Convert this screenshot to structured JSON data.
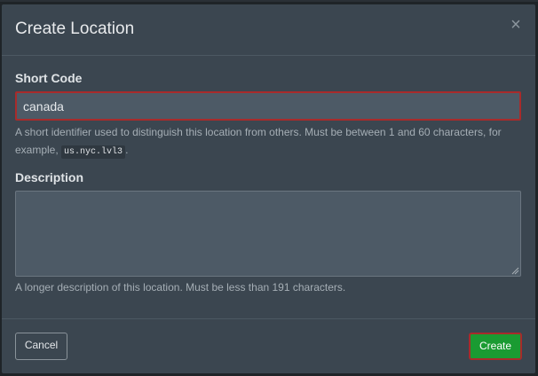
{
  "modal": {
    "title": "Create Location",
    "close_glyph": "×"
  },
  "short_code": {
    "label": "Short Code",
    "value": "canada",
    "help_text": "A short identifier used to distinguish this location from others. Must be between 1 and 60 characters, for example,",
    "help_example": "us.nyc.lvl3",
    "help_suffix": "."
  },
  "description": {
    "label": "Description",
    "value": "",
    "help_text": "A longer description of this location. Must be less than 191 characters."
  },
  "footer": {
    "cancel_label": "Cancel",
    "create_label": "Create"
  },
  "colors": {
    "modal_bg": "#3b4650",
    "error_border": "#a82b2b",
    "create_button": "#1a9b32"
  }
}
